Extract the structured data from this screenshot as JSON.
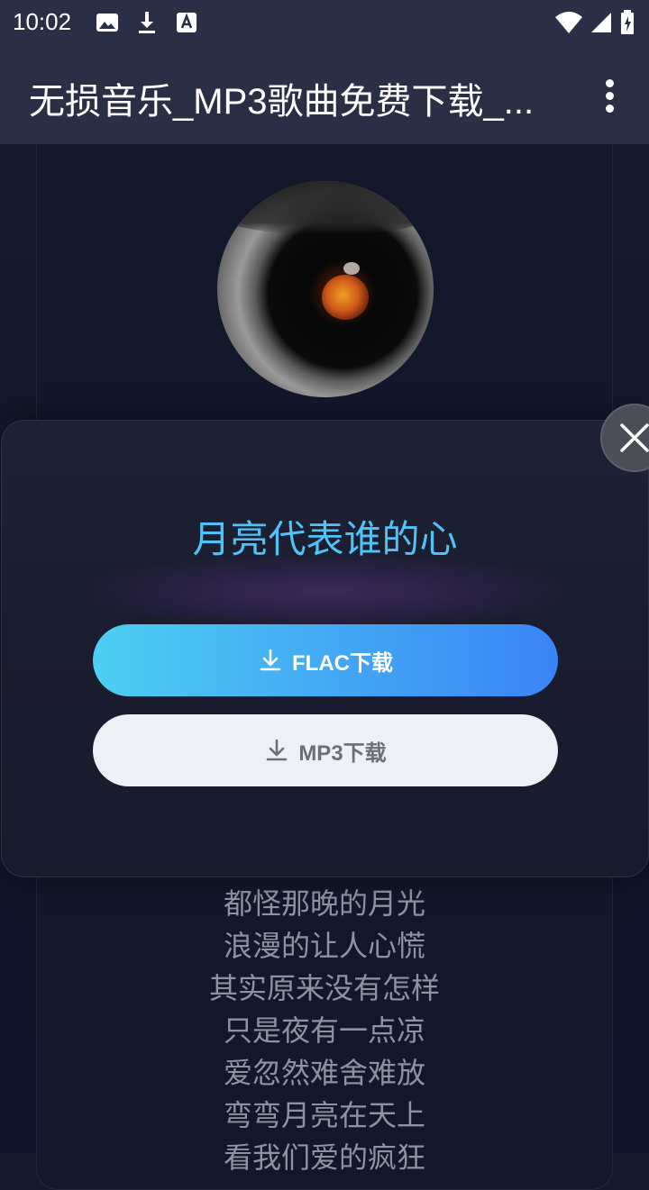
{
  "status_bar": {
    "time": "10:02",
    "left_icons": [
      "image-icon",
      "download-icon",
      "a-badge-icon"
    ],
    "right_icons": [
      "wifi-icon",
      "signal-icon",
      "battery-icon"
    ]
  },
  "app_bar": {
    "title": "无损音乐_MP3歌曲免费下载_...",
    "menu_icon": "more-vert-icon"
  },
  "dialog": {
    "song_title": "月亮代表谁的心",
    "flac_button": "FLAC下载",
    "mp3_button": "MP3下载",
    "close_icon": "close-icon"
  },
  "lyrics": [
    "都怪那晚的月光",
    "浪漫的让人心慌",
    "其实原来没有怎样",
    "只是夜有一点凉",
    "爱忽然难舍难放",
    "弯弯月亮在天上",
    "看我们爱的疯狂"
  ],
  "colors": {
    "app_bar": "#2b2f45",
    "title_accent": "#4fc3f7",
    "flac_gradient_start": "#4dcff2",
    "flac_gradient_end": "#3a84f6",
    "mp3_button_bg": "#eef0f5"
  }
}
